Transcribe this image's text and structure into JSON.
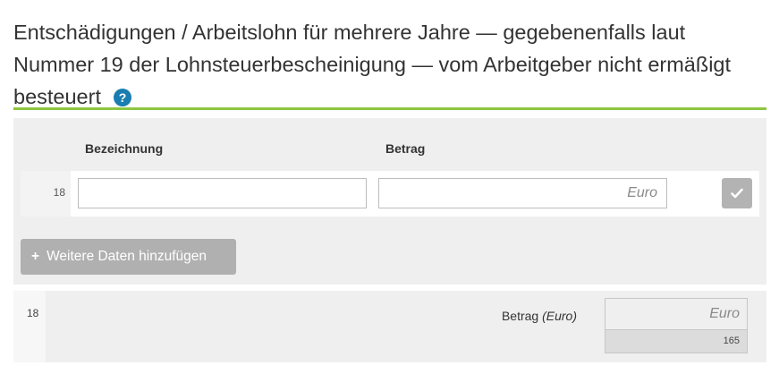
{
  "section": {
    "title": "Entschädigungen / Arbeitslohn für mehrere Jahre — gegebenenfalls laut Nummer 19 der Lohnsteuerbescheinigung — vom Arbeitgeber nicht ermäßigt besteuert",
    "help_symbol": "?"
  },
  "table": {
    "columns": [
      "Bezeichnung",
      "Betrag"
    ],
    "rows": [
      {
        "line_number": "18",
        "bezeichnung": "",
        "betrag": "",
        "betrag_placeholder": "Euro"
      }
    ],
    "confirm_icon": "checkmark-icon"
  },
  "add_button": {
    "plus": "+",
    "label": "Weitere Daten hinzufügen"
  },
  "summary": {
    "line_number": "18",
    "label": "Betrag",
    "unit": "(Euro)",
    "value": "",
    "placeholder": "Euro",
    "field_code": "165"
  },
  "colors": {
    "accent_green": "#8cc63f",
    "help_blue": "#1a7db0",
    "panel_bg": "#efefef"
  }
}
